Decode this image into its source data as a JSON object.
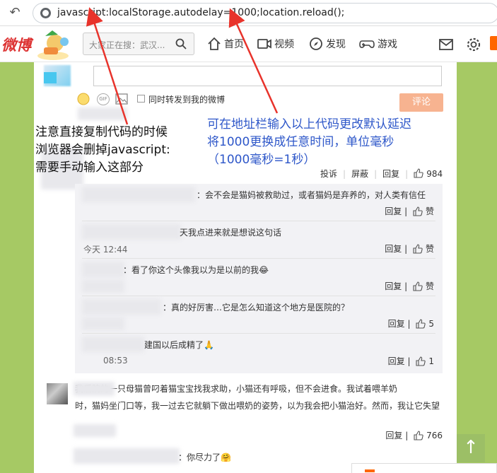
{
  "browser": {
    "back_label": "↶",
    "url": "javascript:localStorage.autodelay=1000;location.reload();"
  },
  "header": {
    "logo": "微博",
    "search_placeholder": "大家正在搜：武汉...",
    "nav": [
      {
        "label": "首页",
        "icon": "home-icon"
      },
      {
        "label": "视频",
        "icon": "video-icon"
      },
      {
        "label": "发现",
        "icon": "compass-icon"
      },
      {
        "label": "游戏",
        "icon": "gamepad-icon"
      }
    ],
    "accent": "#ff6600"
  },
  "composer": {
    "forward_label": "同时转发到我的微博",
    "submit_label": "评论",
    "gif_label": "GIF"
  },
  "annotations": {
    "left": [
      "注意直接复制代码的时候",
      "浏览器会删掉javascript:",
      "需要手动输入这部分"
    ],
    "right": [
      "可在地址栏输入以上代码更改默认延迟",
      "将1000更换成任意时间，单位毫秒",
      "（1000毫秒=1秒）"
    ],
    "arrow_color": "#e8332b",
    "right_color": "#2e57c9"
  },
  "post_actions": {
    "report": "投诉",
    "block": "屏蔽",
    "reply": "回复",
    "likes": "984"
  },
  "replies": [
    {
      "text": "：会不会是猫妈被救助过，或者猫妈是弃养的，对人类有信任",
      "time": "",
      "reply": "回复",
      "like": "赞"
    },
    {
      "text": "天我点进来就是想说这句话",
      "time": "今天 12:44",
      "reply": "回复",
      "like": "赞"
    },
    {
      "text": "：看了你这个头像我以为是以前的我😂",
      "time": "",
      "reply": "回复",
      "like": "赞"
    },
    {
      "text": "：真的好厉害…它是怎么知道这个地方是医院的？",
      "time": "",
      "reply": "回复",
      "like": "5"
    },
    {
      "text": "建国以后成精了🙏",
      "time": "08:53",
      "reply": "回复",
      "like": "1"
    }
  ],
  "comment2": {
    "line1": "我后院的一只母猫曾叼着猫宝宝找我求助，小猫还有呼吸，但不会进食。我试着喂羊奶",
    "line2": "时，猫妈坐门口等，我一过去它就躺下做出喂奶的姿势，以为我会把小猫治好。然而，我让它失望",
    "reply": "回复",
    "likes": "766"
  },
  "comment3": {
    "text": "：你尽力了🤗"
  },
  "scroll_top": "↑"
}
